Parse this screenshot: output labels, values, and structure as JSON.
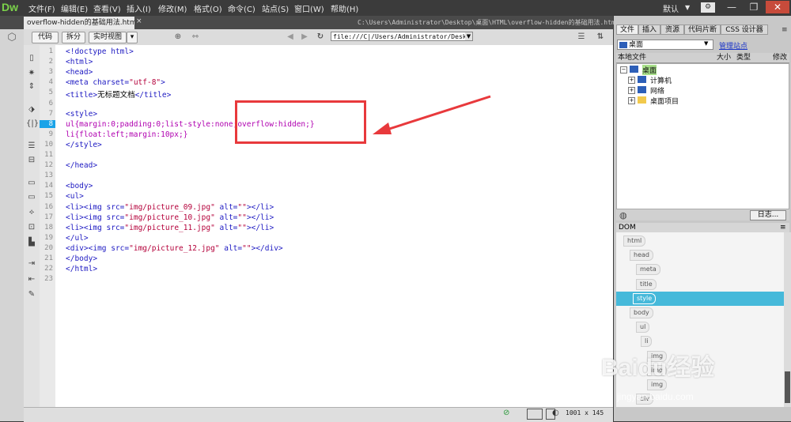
{
  "app": {
    "logo": "Dw",
    "menu": [
      "文件(F)",
      "编辑(E)",
      "查看(V)",
      "插入(I)",
      "修改(M)",
      "格式(O)",
      "命令(C)",
      "站点(S)",
      "窗口(W)",
      "帮助(H)"
    ],
    "workspace": "默认",
    "window_controls": {
      "minimize": "—",
      "restore": "❐",
      "close": "✕"
    }
  },
  "document": {
    "tab_label": "overflow-hidden的基础用法.html",
    "path": "C:\\Users\\Administrator\\Desktop\\桌面\\HTML\\overflow-hidden的基础用法.html",
    "address": "file:///C|/Users/Administrator/Desktop"
  },
  "toolbar": {
    "code": "代码",
    "split": "拆分",
    "live_view": "实时视图"
  },
  "code_lines": [
    {
      "n": "1",
      "text": "<!doctype html>"
    },
    {
      "n": "2",
      "text": "<html>"
    },
    {
      "n": "3",
      "text": "<head>"
    },
    {
      "n": "4",
      "text": "<meta charset=\"utf-8\">"
    },
    {
      "n": "5",
      "text": "<title>无标题文档</title>"
    },
    {
      "n": "6",
      "text": ""
    },
    {
      "n": "7",
      "text": "<style>"
    },
    {
      "n": "8",
      "text": "ul{margin:0;padding:0;list-style:none;overflow:hidden;}"
    },
    {
      "n": "9",
      "text": "li{float:left;margin:10px;}"
    },
    {
      "n": "10",
      "text": "</style>"
    },
    {
      "n": "11",
      "text": ""
    },
    {
      "n": "12",
      "text": "</head>"
    },
    {
      "n": "13",
      "text": ""
    },
    {
      "n": "14",
      "text": "<body>"
    },
    {
      "n": "15",
      "text": "<ul>"
    },
    {
      "n": "16",
      "text": "<li><img src=\"img/picture_09.jpg\" alt=\"\"></li>"
    },
    {
      "n": "17",
      "text": "<li><img src=\"img/picture_10.jpg\" alt=\"\"></li>"
    },
    {
      "n": "18",
      "text": "<li><img src=\"img/picture_11.jpg\" alt=\"\"></li>"
    },
    {
      "n": "19",
      "text": "</ul>"
    },
    {
      "n": "20",
      "text": "<div><img src=\"img/picture_12.jpg\" alt=\"\"></div>"
    },
    {
      "n": "21",
      "text": "</body>"
    },
    {
      "n": "22",
      "text": "</html>"
    },
    {
      "n": "23",
      "text": ""
    }
  ],
  "active_line": "8",
  "status": {
    "size": "1001 x 145"
  },
  "panel": {
    "tabs": [
      "文件",
      "插入",
      "资源",
      "代码片断",
      "CSS 设计器"
    ],
    "site": "桌面",
    "manage_sites": "管理站点",
    "file_headers": {
      "local": "本地文件",
      "size": "大小",
      "type": "类型",
      "modified": "修改"
    },
    "tree": [
      {
        "label": "桌面",
        "level": 0
      },
      {
        "label": "计算机",
        "level": 1
      },
      {
        "label": "网络",
        "level": 1
      },
      {
        "label": "桌面项目",
        "level": 1
      }
    ],
    "log_button": "日志...",
    "dom_title": "DOM",
    "dom_nodes": [
      "html",
      "head",
      "meta",
      "title",
      "style",
      "body",
      "ul",
      "li",
      "img",
      "img",
      "img",
      "div"
    ]
  },
  "watermark": {
    "brand": "Baidu经验",
    "url": "jingyan.baidu.com"
  },
  "colors": {
    "active_line": "#1aa3e8",
    "annotation": "#e8393c",
    "dom_selected": "#46b9da",
    "tag": "#1d19c2",
    "string": "#b4003a"
  }
}
